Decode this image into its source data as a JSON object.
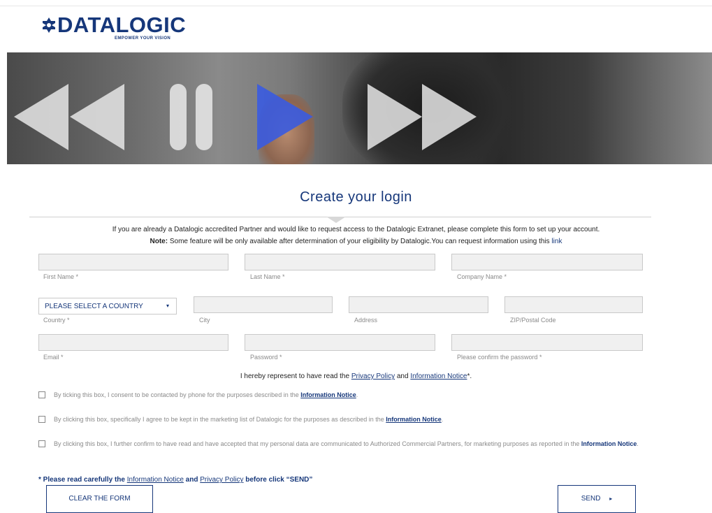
{
  "brand": {
    "logo_text": "DATALOGIC",
    "tagline": "EMPOWER YOUR VISION"
  },
  "page": {
    "title": "Create your login"
  },
  "intro": {
    "line1": "If you are already a Datalogic accredited Partner and would like to request access to the Datalogic Extranet, please complete this form to set up your account.",
    "note_label": "Note:",
    "note_text": " Some feature will be only available after determination of your eligibility by Datalogic.You can request information using this ",
    "link_text": "link"
  },
  "form": {
    "first_name_label": "First Name *",
    "last_name_label": "Last Name *",
    "company_label": "Company Name *",
    "country_select": "PLEASE SELECT A COUNTRY",
    "country_label": "Country *",
    "city_label": "City",
    "address_label": "Address",
    "zip_label": "ZIP/Postal Code",
    "email_label": "Email *",
    "password_label": "Password *",
    "confirm_password_label": "Please confirm the password *"
  },
  "consent": {
    "prefix": "I hereby represent to have read the ",
    "privacy_policy": "Privacy Policy",
    "and": " and ",
    "information_notice": "Information Notice",
    "suffix": "*."
  },
  "checkboxes": [
    {
      "text": "By ticking this box, I consent to be contacted by phone for the purposes described in the ",
      "link": "Information Notice",
      "end": "."
    },
    {
      "text": "By clicking this box, specifically I agree to be kept in the marketing list of Datalogic for the purposes as described in the ",
      "link": "Information Notice",
      "end": "."
    },
    {
      "text": "By clicking this box, I further confirm to have read and have accepted that my personal data are communicated to Authorized Commercial Partners, for marketing purposes as reported in the ",
      "link": "Information Notice",
      "end": "."
    }
  ],
  "footer_note": {
    "prefix": "* Please read carefully the ",
    "information_notice": "Information Notice",
    "and": " and ",
    "privacy_policy": "Privacy Policy",
    "suffix": " before click “SEND”"
  },
  "buttons": {
    "clear": "CLEAR THE FORM",
    "send": "SEND",
    "send_icon": "▸"
  },
  "colors": {
    "brand_blue": "#16377a",
    "field_bg": "#f0f0f0",
    "media_blue": "#3a5be0"
  },
  "icons": {
    "select_caret": "▾",
    "checkbox": "checkbox-icon"
  }
}
